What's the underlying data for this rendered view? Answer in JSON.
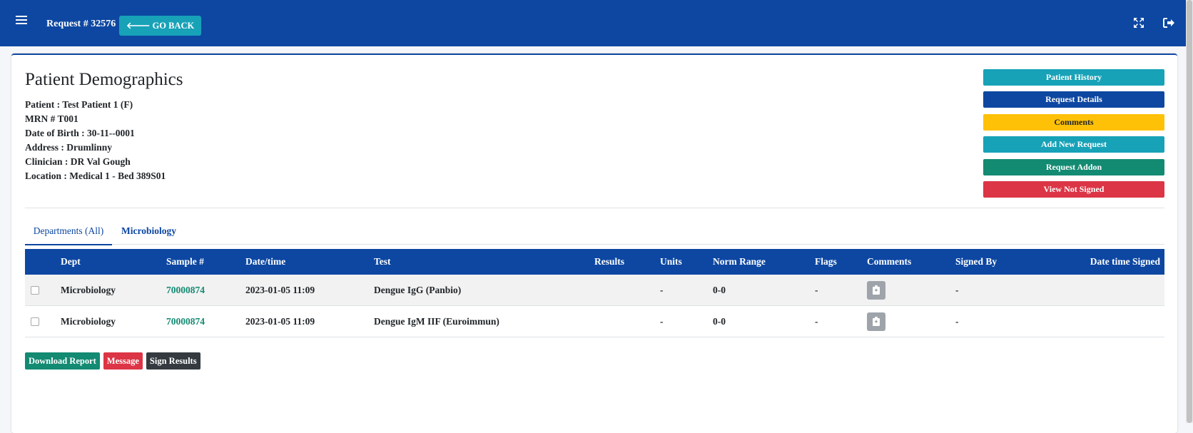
{
  "header": {
    "request_title": "Request # 32576",
    "go_back_label": "GO BACK"
  },
  "patient": {
    "heading": "Patient Demographics",
    "lines": [
      "Patient : Test Patient 1 (F)",
      "MRN # T001",
      "Date of Birth : 30-11--0001",
      "Address : Drumlinny",
      "Clinician : DR Val Gough",
      "Location : Medical 1 - Bed 389S01"
    ]
  },
  "actions": {
    "patient_history": "Patient History",
    "request_details": "Request Details",
    "comments": "Comments",
    "add_new_request": "Add New Request",
    "request_addon": "Request Addon",
    "view_not_signed": "View Not Signed"
  },
  "tabs": {
    "departments_all": "Departments (All)",
    "microbiology": "Microbiology"
  },
  "table": {
    "columns": {
      "dept": "Dept",
      "sample": "Sample #",
      "datetime": "Date/time",
      "test": "Test",
      "results": "Results",
      "units": "Units",
      "norm_range": "Norm Range",
      "flags": "Flags",
      "comments": "Comments",
      "signed_by": "Signed By",
      "date_time_signed": "Date time Signed"
    },
    "rows": [
      {
        "dept": "Microbiology",
        "sample": "70000874",
        "datetime": "2023-01-05 11:09",
        "test": "Dengue IgG (Panbio)",
        "results": "",
        "units": "-",
        "norm_range": "0-0",
        "flags": "-",
        "signed_by": "-",
        "date_time_signed": ""
      },
      {
        "dept": "Microbiology",
        "sample": "70000874",
        "datetime": "2023-01-05 11:09",
        "test": "Dengue IgM IIF (Euroimmun)",
        "results": "",
        "units": "-",
        "norm_range": "0-0",
        "flags": "-",
        "signed_by": "-",
        "date_time_signed": ""
      }
    ]
  },
  "bottom": {
    "download_report": "Download Report",
    "message": "Message",
    "sign_results": "Sign Results"
  },
  "colors": {
    "primary": "#0d47a1",
    "info": "#17a2b8",
    "warning": "#ffc107",
    "success": "#138a72",
    "danger": "#dc3545",
    "dark": "#343a40",
    "secondary": "#9ea4aa"
  },
  "icons": {
    "menu": "hamburger-icon",
    "back": "arrow-left-icon",
    "fullscreen": "expand-icon",
    "logout": "sign-out-icon",
    "comment": "clipboard-icon"
  }
}
